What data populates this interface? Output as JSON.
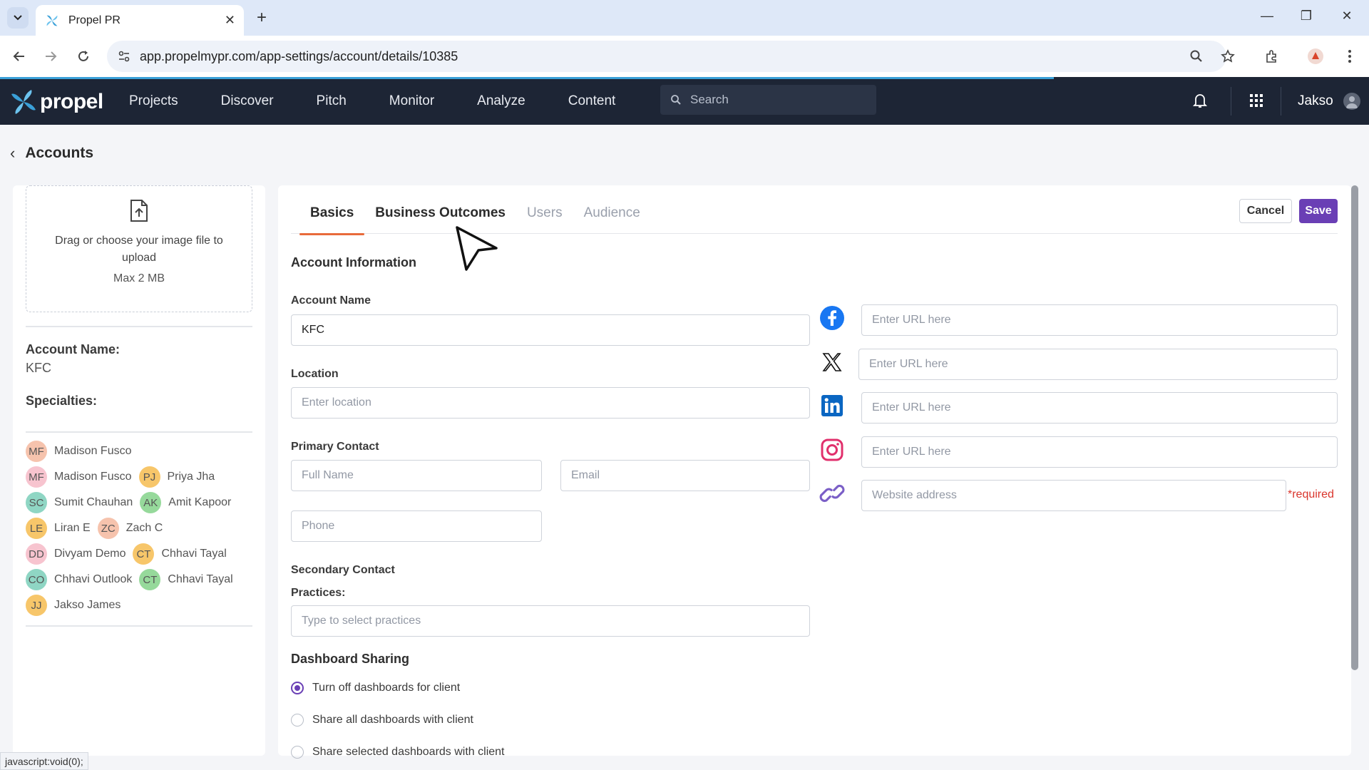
{
  "browser": {
    "tab_title": "Propel PR",
    "url": "app.propelmypr.com/app-settings/account/details/10385",
    "status_text": "javascript:void(0);"
  },
  "header": {
    "logo_text": "propel",
    "nav": [
      "Projects",
      "Discover",
      "Pitch",
      "Monitor",
      "Analyze",
      "Content"
    ],
    "search_placeholder": "Search",
    "user_name": "Jakso"
  },
  "page": {
    "back_title": "Accounts"
  },
  "left": {
    "upload_text": "Drag or choose your image file to upload",
    "upload_limit": "Max 2 MB",
    "account_name_label": "Account Name:",
    "account_name_value": "KFC",
    "specialties_label": "Specialties:",
    "people": [
      [
        {
          "initials": "MF",
          "name": "Madison Fusco",
          "color": "#f6c3ad"
        }
      ],
      [
        {
          "initials": "MF",
          "name": "Madison Fusco",
          "color": "#f7c4cf"
        },
        {
          "initials": "PJ",
          "name": "Priya Jha",
          "color": "#f7c66a"
        }
      ],
      [
        {
          "initials": "SC",
          "name": "Sumit Chauhan",
          "color": "#8fd6c4"
        },
        {
          "initials": "AK",
          "name": "Amit Kapoor",
          "color": "#96d99b"
        }
      ],
      [
        {
          "initials": "LE",
          "name": "Liran E",
          "color": "#f7c66a"
        },
        {
          "initials": "ZC",
          "name": "Zach C",
          "color": "#f6c3ad"
        }
      ],
      [
        {
          "initials": "DD",
          "name": "Divyam Demo",
          "color": "#f7c4cf"
        },
        {
          "initials": "CT",
          "name": "Chhavi Tayal",
          "color": "#f7c66a"
        }
      ],
      [
        {
          "initials": "CO",
          "name": "Chhavi Outlook",
          "color": "#8fd6c4"
        },
        {
          "initials": "CT",
          "name": "Chhavi Tayal",
          "color": "#96d99b"
        }
      ],
      [
        {
          "initials": "JJ",
          "name": "Jakso James",
          "color": "#f7c66a"
        }
      ]
    ]
  },
  "main": {
    "tabs": [
      "Basics",
      "Business Outcomes",
      "Users",
      "Audience"
    ],
    "cancel_label": "Cancel",
    "save_label": "Save",
    "section_title": "Account Information",
    "account_name_label": "Account Name",
    "account_name_value": "KFC",
    "location_label": "Location",
    "location_placeholder": "Enter location",
    "primary_contact_label": "Primary Contact",
    "full_name_placeholder": "Full Name",
    "email_placeholder": "Email",
    "phone_placeholder": "Phone",
    "secondary_contact_label": "Secondary Contact",
    "practices_label": "Practices:",
    "practices_placeholder": "Type to select practices",
    "dashboard_title": "Dashboard Sharing",
    "dashboard_options": [
      "Turn off dashboards for client",
      "Share all dashboards with client",
      "Share selected dashboards with client"
    ],
    "dashboard_selected_index": 0,
    "social": [
      {
        "icon": "facebook-icon",
        "placeholder": "Enter URL here"
      },
      {
        "icon": "x-twitter-icon",
        "placeholder": "Enter URL here"
      },
      {
        "icon": "linkedin-icon",
        "placeholder": "Enter URL here"
      },
      {
        "icon": "instagram-icon",
        "placeholder": "Enter URL here"
      },
      {
        "icon": "link-icon",
        "placeholder": "Website address"
      }
    ],
    "required_text": "*required"
  },
  "colors": {
    "header_bg": "#1d2535",
    "accent": "#6a3fb5",
    "tab_underline": "#e86a3a",
    "required": "#d9342b"
  }
}
